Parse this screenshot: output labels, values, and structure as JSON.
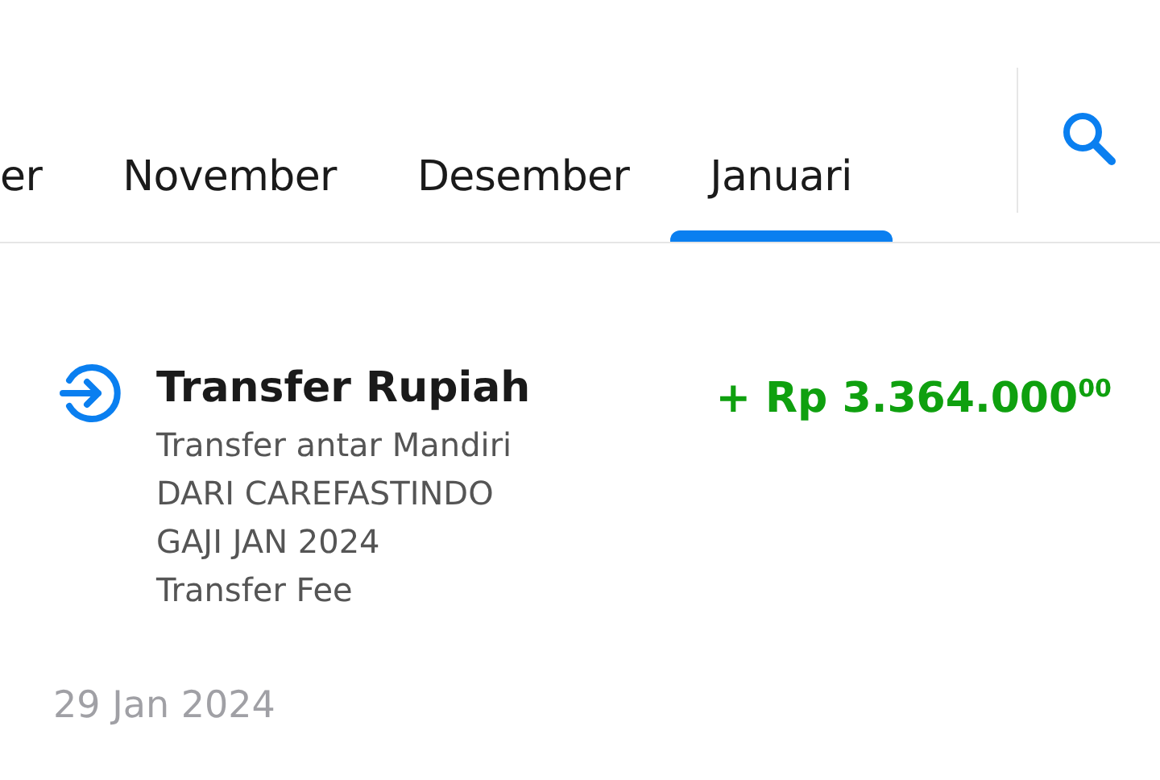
{
  "tabs": [
    {
      "label": "er",
      "selected": false
    },
    {
      "label": "November",
      "selected": false
    },
    {
      "label": "Desember",
      "selected": false
    },
    {
      "label": "Januari",
      "selected": true
    }
  ],
  "transactions": [
    {
      "title": "Transfer Rupiah",
      "kind": "incoming",
      "amount": "+ Rp 3.364.000$^{00}$",
      "details": [
        "Transfer antar Mandiri",
        "DARI CAREFASTINDO",
        "GAJI JAN 2024",
        "Transfer Fee"
      ]
    }
  ],
  "next_date": "29 Jan 2024"
}
